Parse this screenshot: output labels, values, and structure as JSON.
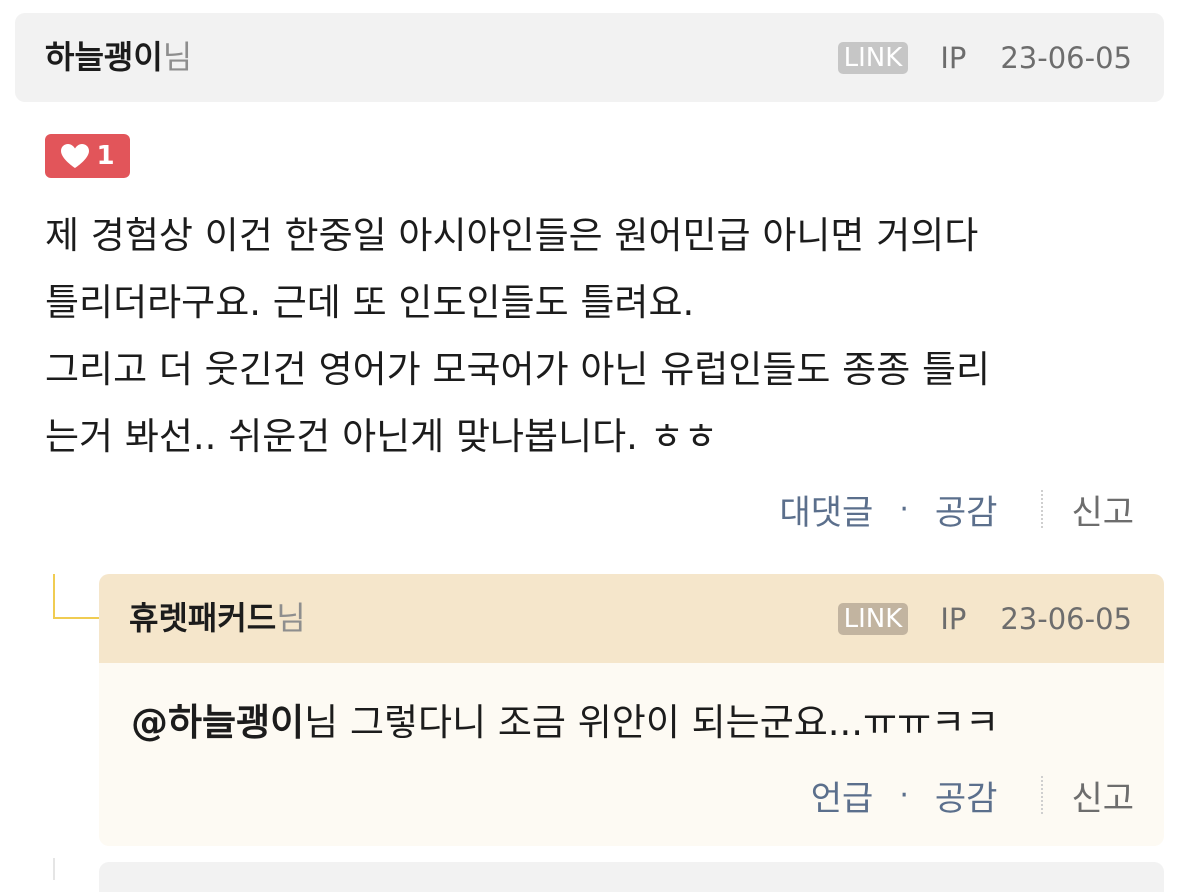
{
  "comment": {
    "author": "하늘괭이",
    "author_suffix": "님",
    "link_badge": "LINK",
    "ip": "IP",
    "date": "23-06-05",
    "likes": "1",
    "body_lines": [
      "제 경험상 이건 한중일 아시아인들은 원어민급 아니면 거의다",
      "틀리더라구요. 근데 또 인도인들도 틀려요.",
      "그리고 더 웃긴건 영어가 모국어가 아닌 유럽인들도 종종 틀리",
      "는거 봐선.. 쉬운건 아닌게 맞나봅니다. ㅎㅎ"
    ],
    "actions": {
      "reply": "대댓글",
      "separator": "·",
      "like": "공감",
      "report": "신고"
    }
  },
  "reply": {
    "author": "휴렛패커드",
    "author_suffix": "님",
    "link_badge": "LINK",
    "ip": "IP",
    "date": "23-06-05",
    "mention": "@하늘괭이",
    "text": "님 그렇다니 조금 위안이 되는군요...ㅠㅠㅋㅋ",
    "actions": {
      "mention": "언급",
      "separator": "·",
      "like": "공감",
      "report": "신고"
    }
  },
  "colors": {
    "like_badge": "#e2555a",
    "action_link": "#5b6f8c",
    "reply_header": "#f5e6cb",
    "reply_connector": "#f0cc52"
  }
}
